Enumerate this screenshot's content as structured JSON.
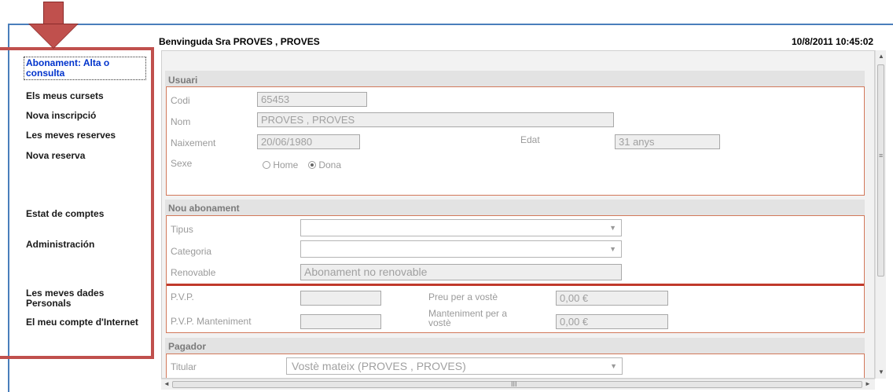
{
  "header": {
    "welcome": "Benvinguda Sra PROVES , PROVES",
    "datetime": "10/8/2011 10:45:02"
  },
  "sidebar": {
    "items": [
      {
        "label": "Abonament: Alta o consulta"
      },
      {
        "label": "Els meus cursets"
      },
      {
        "label": "Nova inscripció"
      },
      {
        "label": "Les meves reserves"
      },
      {
        "label": "Nova reserva"
      },
      {
        "label": "Estat de comptes"
      },
      {
        "label": "Administración"
      },
      {
        "label": "Les meves dades Personals"
      },
      {
        "label": "El meu compte d'Internet"
      }
    ]
  },
  "usuari": {
    "title": "Usuari",
    "codi_label": "Codi",
    "codi_value": "65453",
    "nom_label": "Nom",
    "nom_value": "PROVES , PROVES",
    "naixement_label": "Naixement",
    "naixement_value": "20/06/1980",
    "edat_label": "Edat",
    "edat_value": "31 anys",
    "sexe_label": "Sexe",
    "sexe_options": [
      "Home",
      "Dona"
    ],
    "sexe_selected": "Dona"
  },
  "nou_abonament": {
    "title": "Nou abonament",
    "tipus_label": "Tipus",
    "tipus_value": "",
    "categoria_label": "Categoria",
    "categoria_value": "",
    "renovable_label": "Renovable",
    "renovable_value": "Abonament no renovable",
    "pvp_label": "P.V.P.",
    "pvp_value": "",
    "preu_label": "Preu per a vostè",
    "preu_value": "0,00 €",
    "pvp_manteniment_label": "P.V.P. Manteniment",
    "pvp_manteniment_value": "",
    "manteniment_label": "Manteniment per a vostè",
    "manteniment_value": "0,00 €"
  },
  "pagador": {
    "title": "Pagador",
    "titular_label": "Titular",
    "titular_value": "Vostè mateix (PROVES , PROVES)"
  },
  "scrollbar": {
    "h_grip": "III",
    "v_grip": "≡"
  }
}
